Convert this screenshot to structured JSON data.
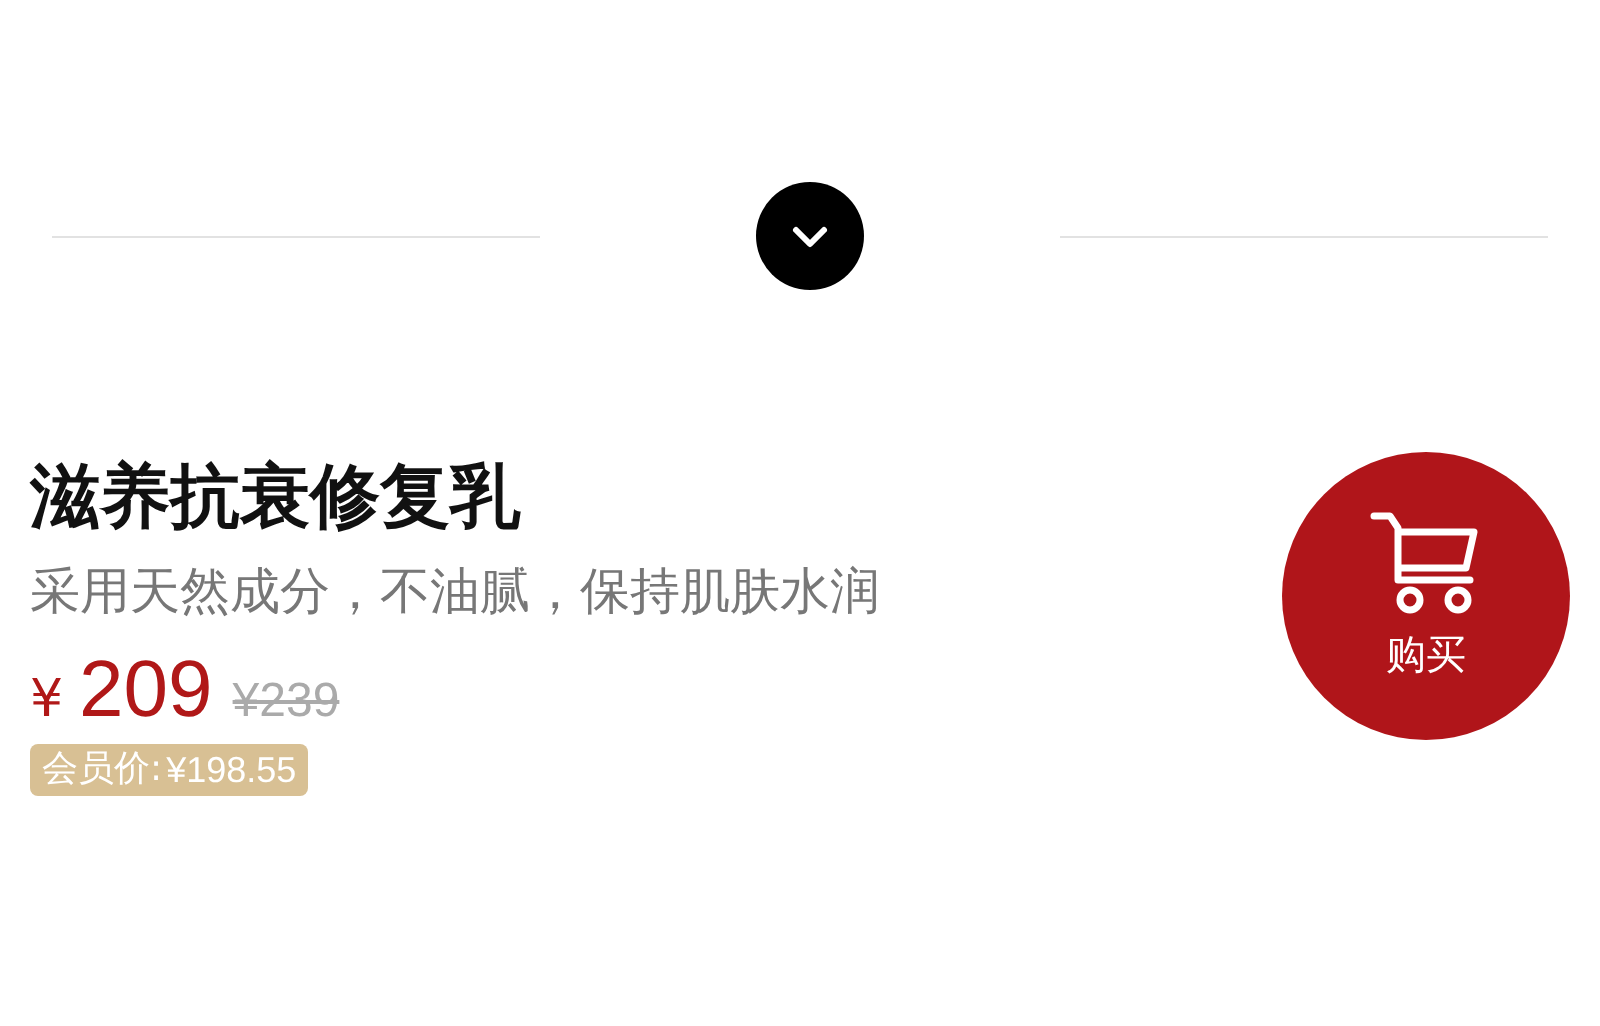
{
  "title": "滋养抗衰修复乳",
  "subtitle": "采用天然成分，不油腻，保持肌肤水润",
  "price": {
    "currency": "¥",
    "value": "209",
    "original": "¥239"
  },
  "member_price": {
    "label": "会员价:",
    "value": "¥198.55"
  },
  "buy_button": {
    "label": "购买"
  }
}
